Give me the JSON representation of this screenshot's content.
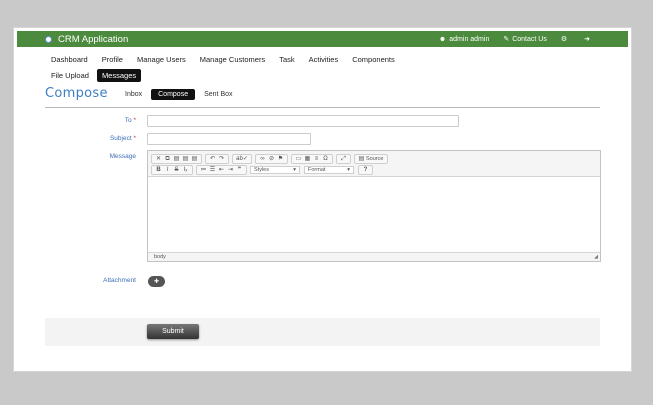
{
  "app": {
    "title": "CRM Application"
  },
  "topbar": {
    "user": "admin admin",
    "contact": "Contact Us"
  },
  "nav": {
    "items": [
      "Dashboard",
      "Profile",
      "Manage Users",
      "Manage Customers",
      "Task",
      "Activities",
      "Components"
    ],
    "row2": [
      "File Upload",
      "Messages"
    ],
    "active": "Messages"
  },
  "page": {
    "title": "Compose",
    "tabs": [
      "Inbox",
      "Compose",
      "Sent Box"
    ],
    "active_tab": "Compose"
  },
  "form": {
    "to_label": "To",
    "subject_label": "Subject",
    "message_label": "Message",
    "attachment_label": "Attachment",
    "required_mark": "*",
    "to_value": "",
    "subject_value": "",
    "submit_label": "Submit"
  },
  "editor": {
    "source_label": "Source",
    "styles_label": "Styles",
    "format_label": "Format",
    "status_path": "body",
    "buttons_row1": [
      "✕",
      "⧉",
      "▤",
      "▤",
      "▤",
      "↶",
      "↷",
      "ab✓",
      "∞",
      "⊘",
      "⚑",
      "▭",
      "▦",
      "≡",
      "Ω",
      "⤢"
    ],
    "buttons_row2": [
      "B",
      "I",
      "S",
      "Iₓ",
      "≔",
      "☰",
      "⇤",
      "⇥",
      "❞",
      "?"
    ]
  },
  "colors": {
    "topbar": "#4c8a3d",
    "accent": "#3d7ec7",
    "pill": "#111111"
  }
}
